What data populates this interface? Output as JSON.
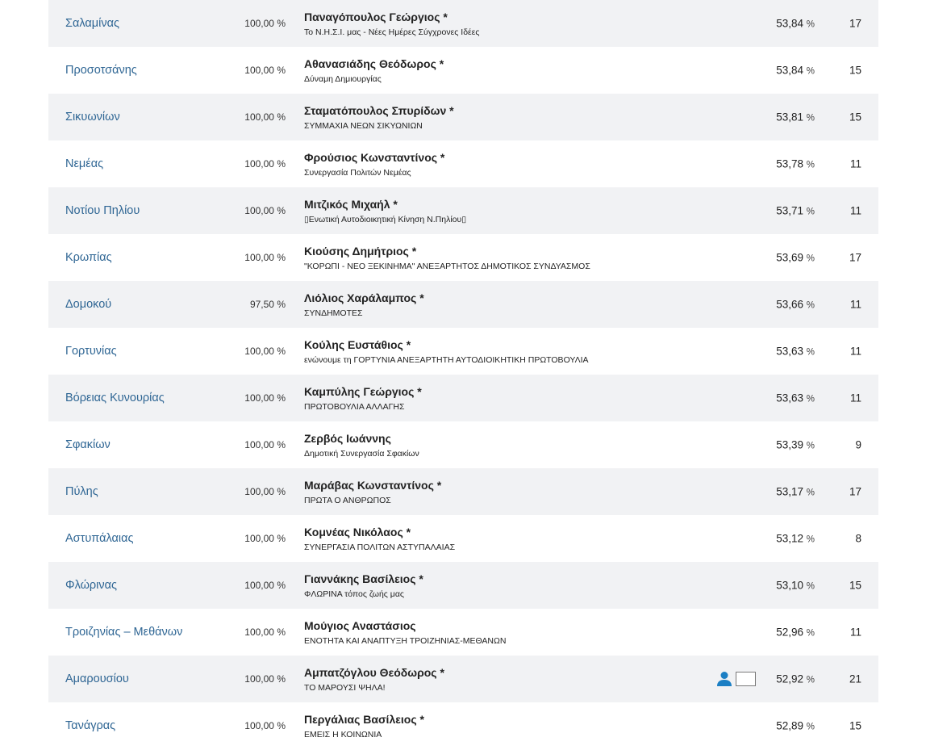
{
  "rows": [
    {
      "municipality": "Σαλαμίνας",
      "counted": "100,00 %",
      "candidate": "Παναγόπουλος Γεώργιος *",
      "party": "Το Ν.Η.Σ.Ι. μας - Νέες Ημέρες Σύγχρονες Ιδέες",
      "percent": "53,84",
      "seats": "17"
    },
    {
      "municipality": "Προσοτσάνης",
      "counted": "100,00 %",
      "candidate": "Αθανασιάδης Θεόδωρος *",
      "party": "Δύναμη Δημιουργίας",
      "percent": "53,84",
      "seats": "15"
    },
    {
      "municipality": "Σικυωνίων",
      "counted": "100,00 %",
      "candidate": "Σταματόπουλος Σπυρίδων *",
      "party": "ΣΥΜΜΑΧΙΑ ΝΕΩΝ ΣΙΚΥΩΝΙΩΝ",
      "percent": "53,81",
      "seats": "15"
    },
    {
      "municipality": "Νεμέας",
      "counted": "100,00 %",
      "candidate": "Φρούσιος Κωνσταντίνος *",
      "party": "Συνεργασία Πολιτών Νεμέας",
      "percent": "53,78",
      "seats": "11"
    },
    {
      "municipality": "Νοτίου Πηλίου",
      "counted": "100,00 %",
      "candidate": "Μιτζικός Μιχαήλ *",
      "party": "Ενωτική Αυτοδιοικητική Κίνηση Ν.Πηλίου",
      "percent": "53,71",
      "seats": "11"
    },
    {
      "municipality": "Κρωπίας",
      "counted": "100,00 %",
      "candidate": "Κιούσης Δημήτριος *",
      "party": "\"ΚΟΡΩΠΙ - ΝΕΟ ΞΕΚΙΝΗΜΑ\" ΑΝΕΞΑΡΤΗΤΟΣ ΔΗΜΟΤΙΚΟΣ ΣΥΝΔΥΑΣΜΟΣ",
      "percent": "53,69",
      "seats": "17"
    },
    {
      "municipality": "Δομοκού",
      "counted": "97,50 %",
      "candidate": "Λιόλιος Χαράλαμπος *",
      "party": "ΣΥΝΔΗΜΟΤΕΣ",
      "percent": "53,66",
      "seats": "11"
    },
    {
      "municipality": "Γορτυνίας",
      "counted": "100,00 %",
      "candidate": "Κούλης Ευστάθιος *",
      "party": "ενώνουμε τη ΓΟΡΤΥΝΙΑ ΑΝΕΞΑΡΤΗΤΗ ΑΥΤΟΔΙΟΙΚΗΤΙΚΗ ΠΡΩΤΟΒΟΥΛΙΑ",
      "percent": "53,63",
      "seats": "11"
    },
    {
      "municipality": "Βόρειας Κυνουρίας",
      "counted": "100,00 %",
      "candidate": "Καμπύλης Γεώργιος *",
      "party": "ΠΡΩΤΟΒΟΥΛΙΑ ΑΛΛΑΓΗΣ",
      "percent": "53,63",
      "seats": "11"
    },
    {
      "municipality": "Σφακίων",
      "counted": "100,00 %",
      "candidate": "Ζερβός Ιωάννης",
      "party": "Δημοτική Συνεργασία Σφακίων",
      "percent": "53,39",
      "seats": "9"
    },
    {
      "municipality": "Πύλης",
      "counted": "100,00 %",
      "candidate": "Μαράβας Κωνσταντίνος *",
      "party": "ΠΡΩΤΑ Ο ΑΝΘΡΩΠΟΣ",
      "percent": "53,17",
      "seats": "17"
    },
    {
      "municipality": "Αστυπάλαιας",
      "counted": "100,00 %",
      "candidate": "Κομνέας Νικόλαος *",
      "party": "ΣΥΝΕΡΓΑΣΙΑ ΠΟΛΙΤΩΝ ΑΣΤΥΠΑΛΑΙΑΣ",
      "percent": "53,12",
      "seats": "8"
    },
    {
      "municipality": "Φλώρινας",
      "counted": "100,00 %",
      "candidate": "Γιαννάκης Βασίλειος *",
      "party": "ΦΛΩΡΙΝΑ τόπος ζωής μας",
      "percent": "53,10",
      "seats": "15"
    },
    {
      "municipality": "Τροιζηνίας – Μεθάνων",
      "counted": "100,00 %",
      "candidate": "Μούγιος Αναστάσιος",
      "party": "ΕΝΟΤΗΤΑ ΚΑΙ ΑΝΑΠΤΥΞΗ ΤΡΟΙΖΗΝΙΑΣ-ΜΕΘΑΝΩΝ",
      "percent": "52,96",
      "seats": "11"
    },
    {
      "municipality": "Αμαρουσίου",
      "counted": "100,00 %",
      "candidate": "Αμπατζόγλου Θεόδωρος *",
      "party": "ΤΟ ΜΑΡΟΥΣΙ ΨΗΛΑ!",
      "percent": "52,92",
      "seats": "21",
      "icons": [
        "user-icon",
        "box-icon"
      ]
    },
    {
      "municipality": "Τανάγρας",
      "counted": "100,00 %",
      "candidate": "Περγάλιας Βασίλειος *",
      "party": "ΕΜΕΙΣ Η ΚΟΙΝΩΝΙΑ",
      "percent": "52,89",
      "seats": "15"
    }
  ],
  "percent_unit": "%",
  "colors": {
    "link": "#2f6694",
    "row_shade": "#f1f2f4",
    "icon_blue": "#1b7fc4"
  }
}
